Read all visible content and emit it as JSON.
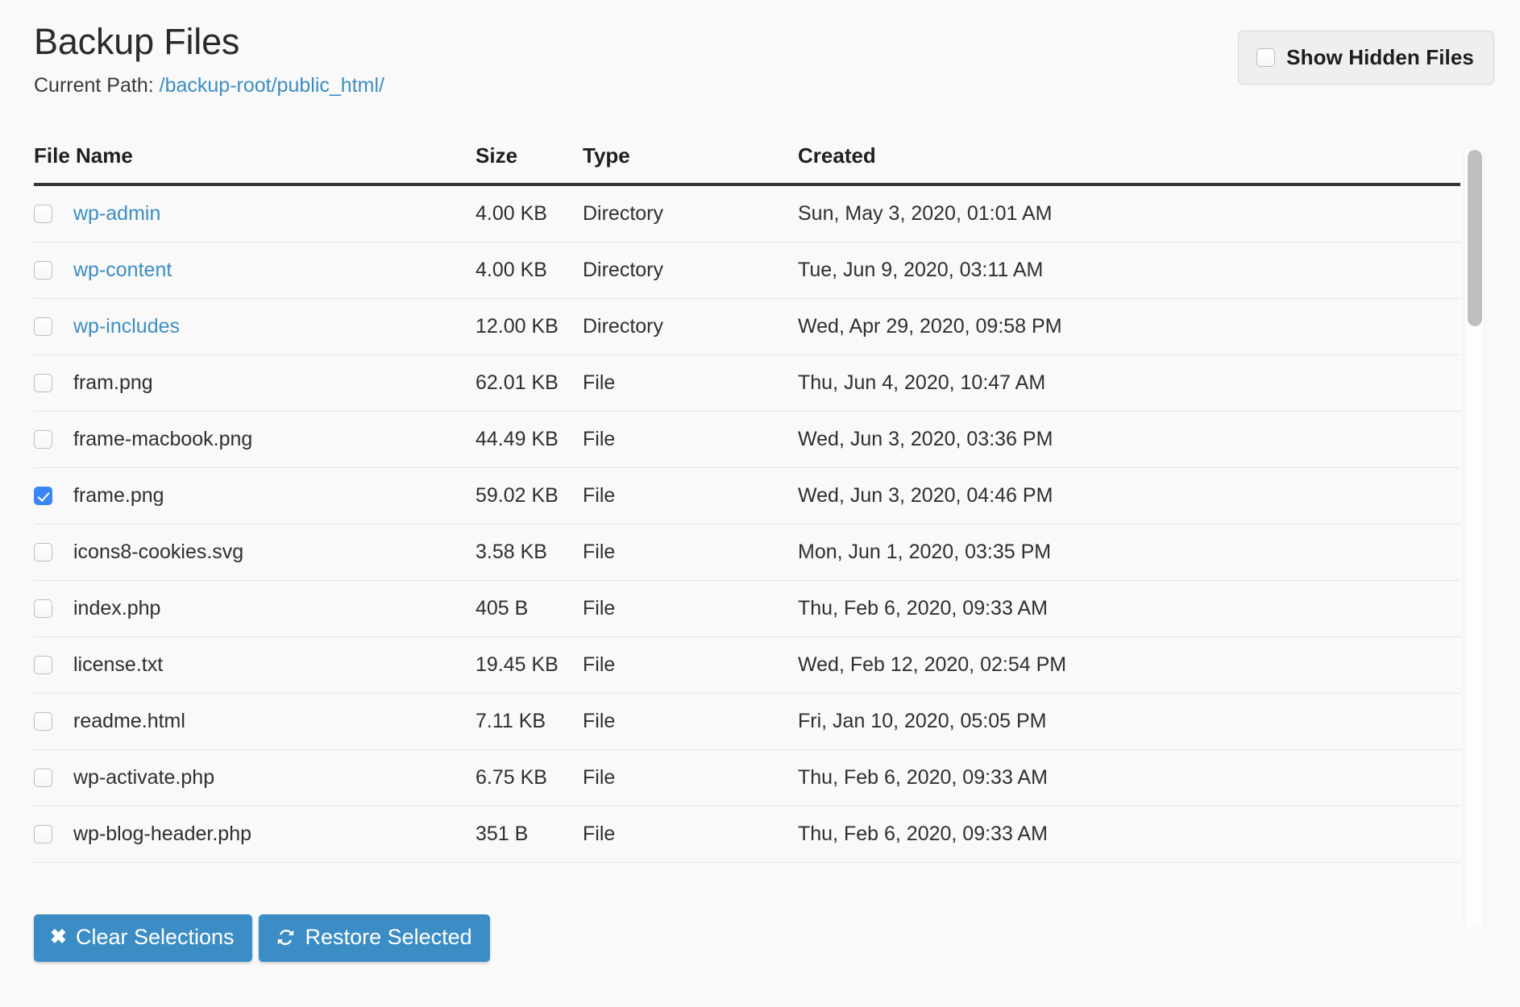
{
  "header": {
    "title": "Backup Files",
    "path_label": "Current Path:",
    "path_value": "/backup-root/public_html/",
    "hidden_files_label": "Show Hidden Files",
    "hidden_files_checked": false
  },
  "table": {
    "columns": [
      "File Name",
      "Size",
      "Type",
      "Created"
    ],
    "rows": [
      {
        "name": "wp-admin",
        "size": "4.00 KB",
        "type": "Directory",
        "created": "Sun, May 3, 2020, 01:01 AM",
        "is_link": true,
        "checked": false
      },
      {
        "name": "wp-content",
        "size": "4.00 KB",
        "type": "Directory",
        "created": "Tue, Jun 9, 2020, 03:11 AM",
        "is_link": true,
        "checked": false
      },
      {
        "name": "wp-includes",
        "size": "12.00 KB",
        "type": "Directory",
        "created": "Wed, Apr 29, 2020, 09:58 PM",
        "is_link": true,
        "checked": false
      },
      {
        "name": "fram.png",
        "size": "62.01 KB",
        "type": "File",
        "created": "Thu, Jun 4, 2020, 10:47 AM",
        "is_link": false,
        "checked": false
      },
      {
        "name": "frame-macbook.png",
        "size": "44.49 KB",
        "type": "File",
        "created": "Wed, Jun 3, 2020, 03:36 PM",
        "is_link": false,
        "checked": false
      },
      {
        "name": "frame.png",
        "size": "59.02 KB",
        "type": "File",
        "created": "Wed, Jun 3, 2020, 04:46 PM",
        "is_link": false,
        "checked": true
      },
      {
        "name": "icons8-cookies.svg",
        "size": "3.58 KB",
        "type": "File",
        "created": "Mon, Jun 1, 2020, 03:35 PM",
        "is_link": false,
        "checked": false
      },
      {
        "name": "index.php",
        "size": "405 B",
        "type": "File",
        "created": "Thu, Feb 6, 2020, 09:33 AM",
        "is_link": false,
        "checked": false
      },
      {
        "name": "license.txt",
        "size": "19.45 KB",
        "type": "File",
        "created": "Wed, Feb 12, 2020, 02:54 PM",
        "is_link": false,
        "checked": false
      },
      {
        "name": "readme.html",
        "size": "7.11 KB",
        "type": "File",
        "created": "Fri, Jan 10, 2020, 05:05 PM",
        "is_link": false,
        "checked": false
      },
      {
        "name": "wp-activate.php",
        "size": "6.75 KB",
        "type": "File",
        "created": "Thu, Feb 6, 2020, 09:33 AM",
        "is_link": false,
        "checked": false
      },
      {
        "name": "wp-blog-header.php",
        "size": "351 B",
        "type": "File",
        "created": "Thu, Feb 6, 2020, 09:33 AM",
        "is_link": false,
        "checked": false
      }
    ]
  },
  "actions": {
    "clear_label": "Clear Selections",
    "clear_icon": "close-x-icon",
    "restore_label": "Restore Selected",
    "restore_icon": "refresh-sync-icon"
  },
  "colors": {
    "accent_blue": "#3c8dc5",
    "link_blue": "#3c8dc5",
    "checkbox_blue": "#3b86f7",
    "page_background": "#f9f9f9",
    "header_rule": "#353535"
  },
  "scrollbar": {
    "thumb_position": "top"
  }
}
